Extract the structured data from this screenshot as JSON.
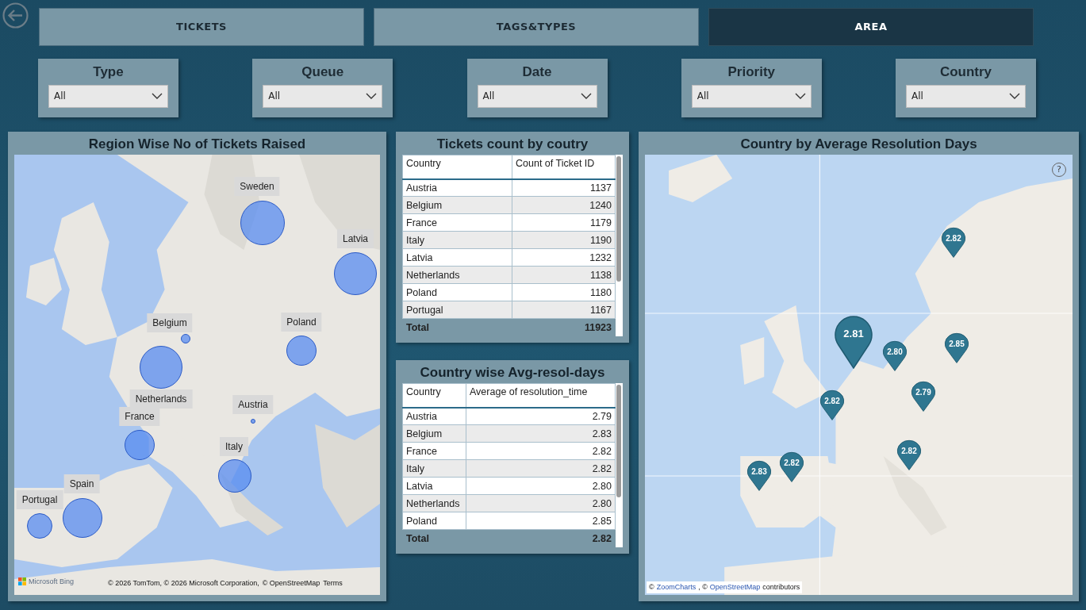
{
  "nav": [
    {
      "label": "TICKETS",
      "selected": false
    },
    {
      "label": "TAGS&TYPES",
      "selected": false
    },
    {
      "label": "AREA",
      "selected": true
    }
  ],
  "filters": [
    {
      "label": "Type",
      "value": "All"
    },
    {
      "label": "Queue",
      "value": "All"
    },
    {
      "label": "Date",
      "value": "All"
    },
    {
      "label": "Priority",
      "value": "All"
    },
    {
      "label": "Country",
      "value": "All"
    }
  ],
  "region_map": {
    "title": "Region Wise No of Tickets Raised",
    "bubbles": [
      {
        "label": "Sweden"
      },
      {
        "label": "Latvia"
      },
      {
        "label": "Poland"
      },
      {
        "label": "Belgium"
      },
      {
        "label": "Netherlands"
      },
      {
        "label": "France"
      },
      {
        "label": "Austria"
      },
      {
        "label": "Italy"
      },
      {
        "label": "Spain"
      },
      {
        "label": "Portugal"
      }
    ],
    "brand": "Microsoft Bing",
    "attribution": "© 2026 TomTom, © 2026 Microsoft Corporation,",
    "attribution_link": "© OpenStreetMap",
    "terms": "Terms"
  },
  "count_table": {
    "title": "Tickets count by coutry",
    "columns": [
      "Country",
      "Count of Ticket ID"
    ],
    "rows": [
      [
        "Austria",
        "1137"
      ],
      [
        "Belgium",
        "1240"
      ],
      [
        "France",
        "1179"
      ],
      [
        "Italy",
        "1190"
      ],
      [
        "Latvia",
        "1232"
      ],
      [
        "Netherlands",
        "1138"
      ],
      [
        "Poland",
        "1180"
      ],
      [
        "Portugal",
        "1167"
      ]
    ],
    "total": [
      "Total",
      "11923"
    ]
  },
  "avg_table": {
    "title": "Country wise Avg-resol-days",
    "columns": [
      "Country",
      "Average of resolution_time"
    ],
    "rows": [
      [
        "Austria",
        "2.79"
      ],
      [
        "Belgium",
        "2.83"
      ],
      [
        "France",
        "2.82"
      ],
      [
        "Italy",
        "2.82"
      ],
      [
        "Latvia",
        "2.80"
      ],
      [
        "Netherlands",
        "2.80"
      ],
      [
        "Poland",
        "2.85"
      ]
    ],
    "total": [
      "Total",
      "2.82"
    ]
  },
  "resolution_map": {
    "title": "Country by Average Resolution Days",
    "help": "?",
    "pins": [
      {
        "value": "2.82",
        "highlighted": false
      },
      {
        "value": "2.81",
        "highlighted": true
      },
      {
        "value": "2.80",
        "highlighted": false
      },
      {
        "value": "2.85",
        "highlighted": false
      },
      {
        "value": "2.82",
        "highlighted": false
      },
      {
        "value": "2.79",
        "highlighted": false
      },
      {
        "value": "2.82",
        "highlighted": false
      },
      {
        "value": "2.83",
        "highlighted": false
      },
      {
        "value": "2.82",
        "highlighted": false
      }
    ],
    "attribution_1": "©",
    "attribution_link_1": "ZoomCharts",
    "attribution_2": ", ©",
    "attribution_link_2": "OpenStreetMap",
    "attribution_3": "contributors"
  }
}
